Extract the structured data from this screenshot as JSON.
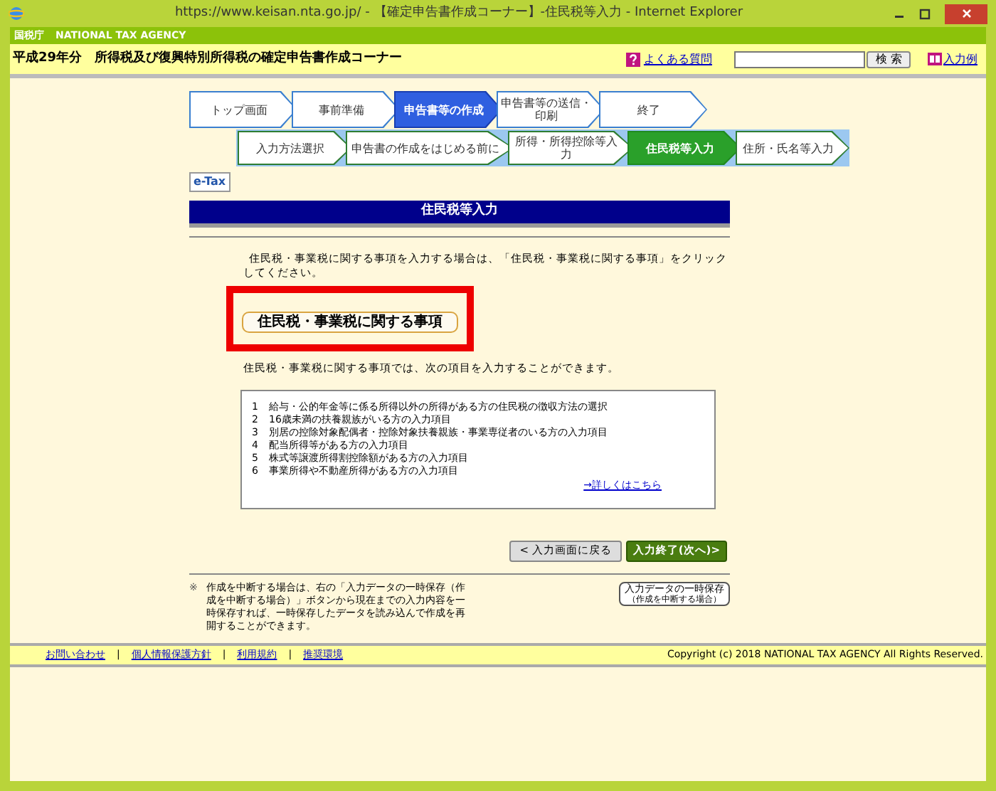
{
  "window": {
    "title": "https://www.keisan.nta.go.jp/ - 【確定申告書作成コーナー】-住民税等入力 - Internet Explorer"
  },
  "agency_bar": {
    "logo": "国税庁",
    "name": "NATIONAL TAX AGENCY"
  },
  "header": {
    "title": "平成29年分　所得税及び復興特別所得税の確定申告書作成コーナー",
    "faq_link": "よくある質問",
    "search_button": "検 索",
    "example_link": "入力例"
  },
  "steps": [
    {
      "label": "トップ画面",
      "selected": false
    },
    {
      "label": "事前準備",
      "selected": false
    },
    {
      "label": "申告書等の作成",
      "selected": true
    },
    {
      "label": "申告書等の送信・印刷",
      "selected": false
    },
    {
      "label": "終了",
      "selected": false
    }
  ],
  "substeps": [
    {
      "label": "入力方法選択",
      "selected": false
    },
    {
      "label": "申告書の作成をはじめる前に",
      "selected": false
    },
    {
      "label": "所得・所得控除等入力",
      "selected": false
    },
    {
      "label": "住民税等入力",
      "selected": true
    },
    {
      "label": "住所・氏名等入力",
      "selected": false
    }
  ],
  "etax_badge": "e-Tax",
  "section_title": "住民税等入力",
  "intro": "住民税・事業税に関する事項を入力する場合は、「住民税・事業税に関する事項」をクリックしてください。",
  "main_button": {
    "label": "住民税・事業税に関する事項",
    "highlighted": true
  },
  "list_intro": "住民税・事業税に関する事項では、次の項目を入力することができます。",
  "items": [
    {
      "number": "1",
      "text": "給与・公的年金等に係る所得以外の所得がある方の住民税の徴収方法の選択"
    },
    {
      "number": "2",
      "text": "16歳未満の扶養親族がいる方の入力項目"
    },
    {
      "number": "3",
      "text": "別居の控除対象配偶者・控除対象扶養親族・事業専従者のいる方の入力項目"
    },
    {
      "number": "4",
      "text": "配当所得等がある方の入力項目"
    },
    {
      "number": "5",
      "text": "株式等譲渡所得割控除額がある方の入力項目"
    },
    {
      "number": "6",
      "text": "事業所得や不動産所得がある方の入力項目"
    }
  ],
  "details_link": "→詳しくはこちら",
  "back_button": "< 入力画面に戻る",
  "next_button": "入力終了(次へ)>",
  "note": {
    "mark": "※",
    "text": "作成を中断する場合は、右の「入力データの一時保存（作成を中断する場合）」ボタンから現在までの入力内容を一時保存すれば、一時保存したデータを読み込んで作成を再開することができます。",
    "save_button": "入力データの一時保存",
    "save_button_sub": "（作成を中断する場合）"
  },
  "footer": {
    "links": [
      "お問い合わせ",
      "個人情報保護方針",
      "利用規約",
      "推奨環境"
    ],
    "separator": "|",
    "copyright": "Copyright (c) 2018 NATIONAL TAX AGENCY All Rights Reserved."
  }
}
